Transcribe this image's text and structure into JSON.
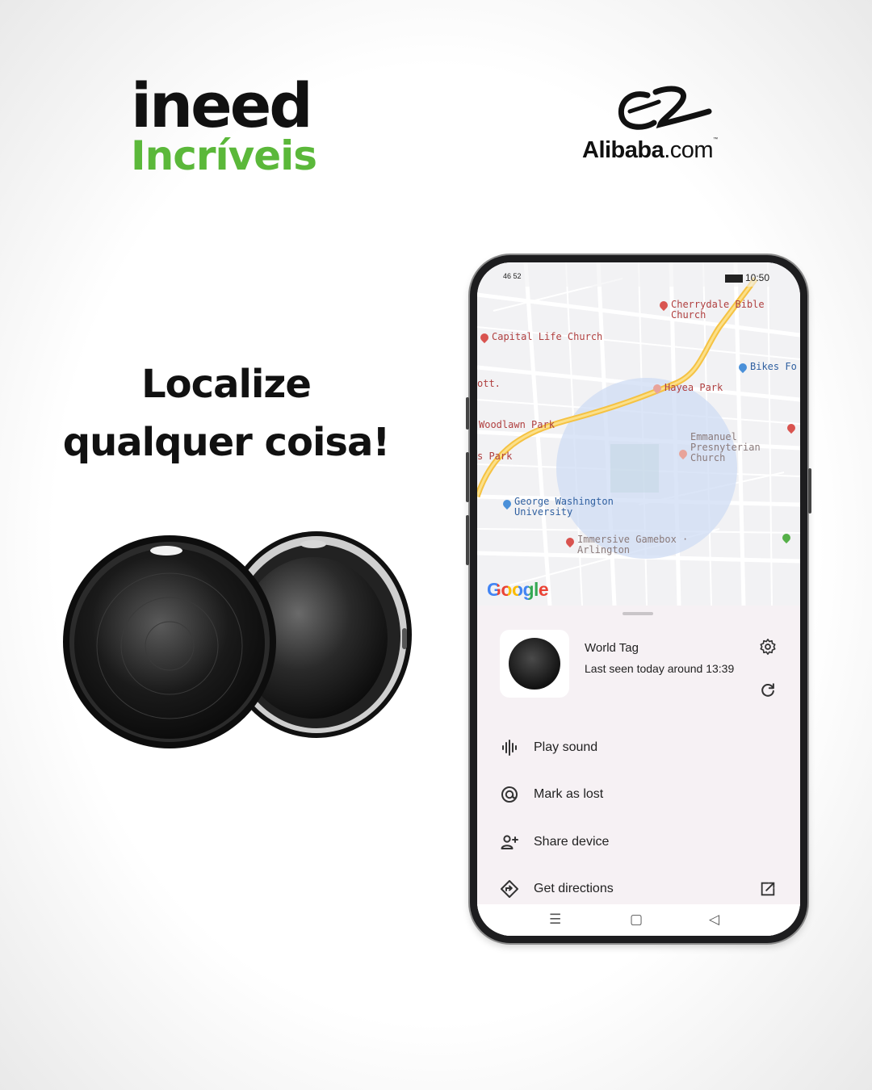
{
  "brand": {
    "line1": "ineed",
    "line2": "Incríveis",
    "green": "#5bb83a"
  },
  "partner": {
    "name": "Alibaba",
    "domain": ".com",
    "tm": "™"
  },
  "headline": {
    "line1": "Localize",
    "line2": "qualquer coisa!"
  },
  "phone": {
    "status": {
      "left": "46 52",
      "time": "10:50"
    },
    "map": {
      "labels": [
        "Cherrydale Bible Church",
        "Capital Life Church",
        "Bikes Fo",
        "Hayea Park",
        "Woodlawn Park",
        "Emmanuel Presnyterian Church",
        "George Washington University",
        "Immersive Gamebox · Arlington",
        "s Park",
        "ott."
      ],
      "logo": "Google"
    },
    "device": {
      "name": "World Tag",
      "last_seen": "Last seen today around 13:39"
    },
    "actions": [
      {
        "icon": "sound-wave-icon",
        "label": "Play sound"
      },
      {
        "icon": "mark-lost-icon",
        "label": "Mark as lost"
      },
      {
        "icon": "person-add-icon",
        "label": "Share device"
      },
      {
        "icon": "directions-icon",
        "label": "Get directions"
      }
    ],
    "nav": {
      "menu": "☰",
      "home": "▢",
      "back": "◁"
    }
  }
}
